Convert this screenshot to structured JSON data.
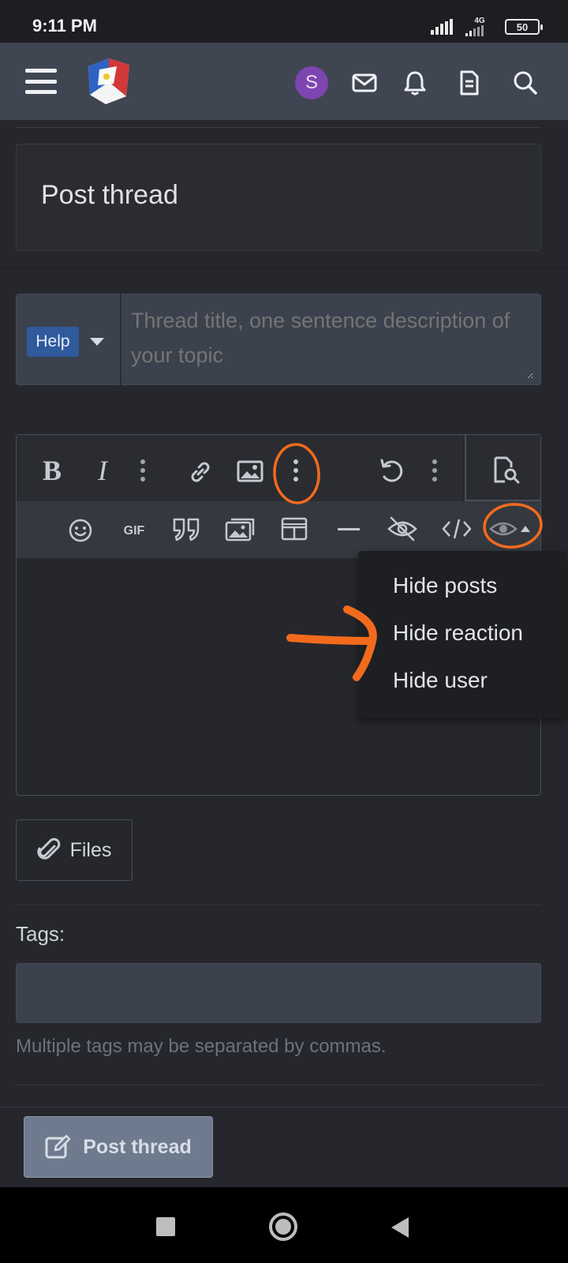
{
  "status_bar": {
    "time": "9:11 PM",
    "network": "4G",
    "battery": "50"
  },
  "header": {
    "avatar_initial": "S",
    "icons": [
      "menu-icon",
      "logo",
      "mail-icon",
      "bell-icon",
      "document-icon",
      "search-icon"
    ]
  },
  "page": {
    "title": "Post thread"
  },
  "thread_form": {
    "prefix_label": "Help",
    "title_placeholder": "Thread title, one sentence description of your topic"
  },
  "editor": {
    "toolbar_row1": [
      "bold-icon",
      "italic-icon",
      "more-vertical-icon",
      "link-icon",
      "image-icon",
      "more-vertical-icon",
      "undo-icon",
      "more-vertical-icon",
      "preview-icon"
    ],
    "toolbar_row2": [
      "emoji-icon",
      "gif-icon",
      "quote-icon",
      "media-gallery-icon",
      "table-icon",
      "horizontal-rule-icon",
      "hide-eye-slash-icon",
      "code-icon",
      "hide-menu-eye-icon"
    ],
    "gif_label": "GIF",
    "hide_menu": {
      "items": [
        "Hide posts",
        "Hide reaction",
        "Hide user"
      ]
    }
  },
  "attachments": {
    "files_label": "Files"
  },
  "tags": {
    "label": "Tags:",
    "hint": "Multiple tags may be separated by commas."
  },
  "actions": {
    "submit_label": "Post thread"
  },
  "colors": {
    "background": "#26272c",
    "header": "#3f4551",
    "input_bg": "#3b414d",
    "prefix_badge": "#2f5a9c",
    "avatar": "#7d45b0",
    "annotation": "#f26b1d",
    "submit_button": "#6e7b8e"
  }
}
